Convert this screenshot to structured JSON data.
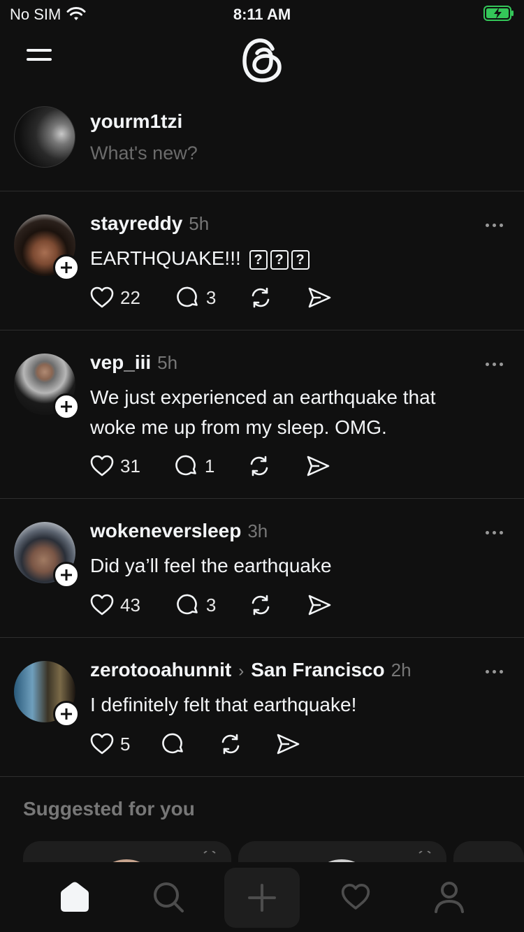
{
  "status_bar": {
    "carrier": "No SIM",
    "time": "8:11 AM"
  },
  "composer": {
    "username": "yourm1tzi",
    "prompt": "What's new?"
  },
  "posts": [
    {
      "username": "stayreddy",
      "time": "5h",
      "text": "EARTHQUAKE!!!",
      "likes": "22",
      "replies": "3"
    },
    {
      "username": "vep_iii",
      "time": "5h",
      "text_line1": "We just experienced an earthquake that",
      "text_line2": "woke me up from my sleep. OMG.",
      "likes": "31",
      "replies": "1"
    },
    {
      "username": "wokeneversleep",
      "time": "3h",
      "text": "Did ya’ll feel the earthquake",
      "likes": "43",
      "replies": "3"
    },
    {
      "username": "zerotooahunnit",
      "location": "San Francisco",
      "time": "2h",
      "text": "I definitely felt that earthquake!",
      "likes": "5",
      "replies": ""
    }
  ],
  "suggested": {
    "title": "Suggested for you"
  },
  "tabs": [
    "home",
    "search",
    "compose",
    "activity",
    "profile"
  ],
  "colors": {
    "background": "#101010",
    "text": "#f3f5f7",
    "muted": "#777777",
    "battery": "#34c759"
  }
}
